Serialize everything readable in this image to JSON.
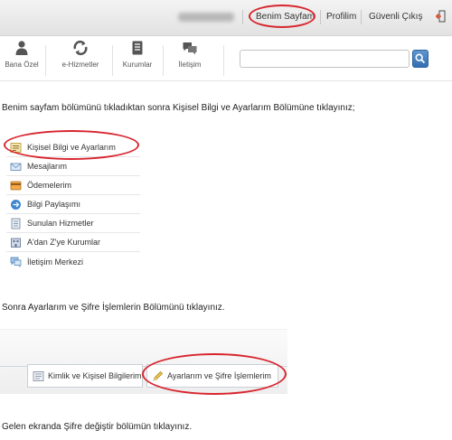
{
  "topbar": {
    "links": [
      {
        "label": "Benim Sayfam"
      },
      {
        "label": "Profilim"
      },
      {
        "label": "Güvenli Çıkış"
      }
    ]
  },
  "toolbar": {
    "items": [
      {
        "label": "Bana Özel",
        "icon": "user-icon"
      },
      {
        "label": "e-Hizmetler",
        "icon": "e-services-icon"
      },
      {
        "label": "Kurumlar",
        "icon": "institutions-icon"
      },
      {
        "label": "İletişim",
        "icon": "contact-icon"
      }
    ],
    "search": {
      "value": "",
      "placeholder": ""
    }
  },
  "instructions": [
    "Benim sayfam bölümünü tıkladıktan sonra Kişisel Bilgi ve Ayarlarım Bölümüne tıklayınız;",
    "Sonra Ayarlarım ve Şifre İşlemlerin Bölümünü tıklayınız.",
    "Gelen ekranda Şifre değiştir bölümün tıklayınız."
  ],
  "menu": {
    "items": [
      {
        "label": "Kişisel Bilgi ve Ayarlarım",
        "icon": "personal-info-icon"
      },
      {
        "label": "Mesajlarım",
        "icon": "envelope-icon"
      },
      {
        "label": "Ödemelerim",
        "icon": "payments-icon"
      },
      {
        "label": "Bilgi Paylaşımı",
        "icon": "share-icon"
      },
      {
        "label": "Sunulan Hizmetler",
        "icon": "services-icon"
      },
      {
        "label": "A'dan Z'ye Kurumlar",
        "icon": "institutions-list-icon"
      },
      {
        "label": "İletişim Merkezi",
        "icon": "chat-icon"
      }
    ]
  },
  "tabs": [
    {
      "label": "Kimlik ve Kişisel Bilgilerim",
      "icon": "id-card-icon"
    },
    {
      "label": "Ayarlarım ve Şifre İşlemlerim",
      "icon": "pencil-icon"
    }
  ],
  "colors": {
    "highlight_ring": "#d8262f",
    "search_button": "#3a74b6",
    "exit_icon": "#e04a2a"
  }
}
